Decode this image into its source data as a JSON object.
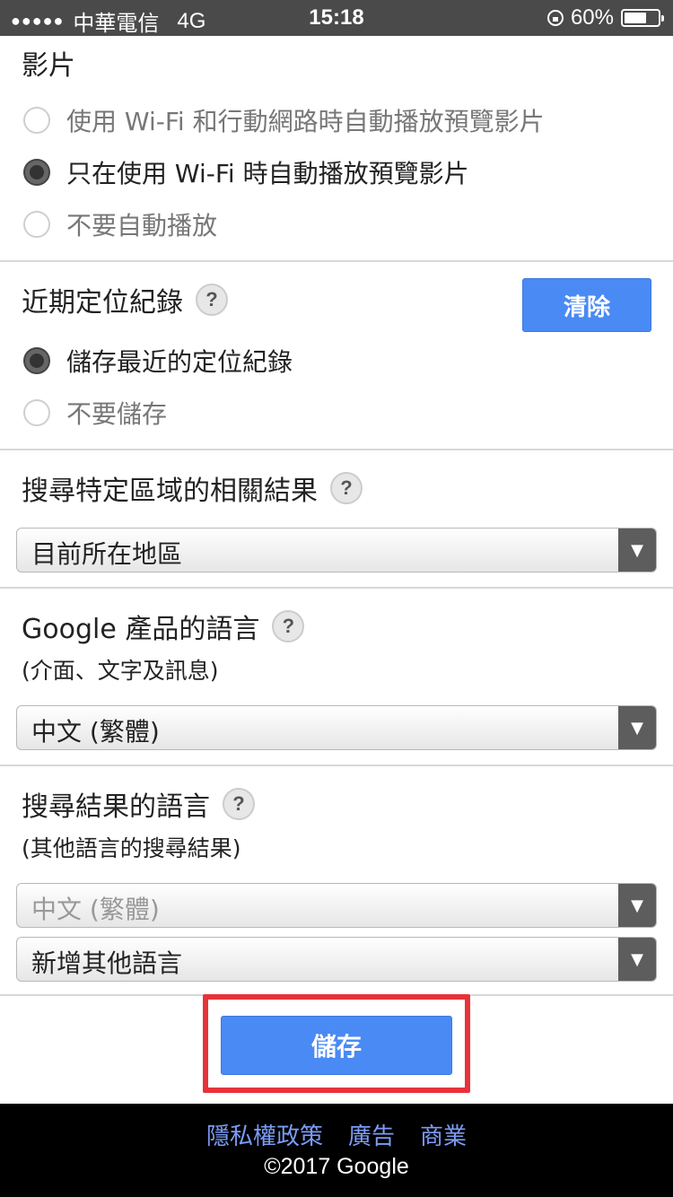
{
  "status_bar": {
    "signal_dots": "●●●●●",
    "carrier": "中華電信",
    "network": "4G",
    "time": "15:18",
    "battery_percent": "60%",
    "battery_level": 0.6
  },
  "video_section": {
    "title": "影片",
    "options": [
      {
        "label": "使用 Wi-Fi 和行動網路時自動播放預覽影片",
        "checked": false
      },
      {
        "label": "只在使用 Wi-Fi 時自動播放預覽影片",
        "checked": true
      },
      {
        "label": "不要自動播放",
        "checked": false
      }
    ]
  },
  "location_section": {
    "title": "近期定位紀錄",
    "help_icon": "?",
    "clear_button": "清除",
    "options": [
      {
        "label": "儲存最近的定位紀錄",
        "checked": true
      },
      {
        "label": "不要儲存",
        "checked": false
      }
    ]
  },
  "region_section": {
    "title": "搜尋特定區域的相關結果",
    "help_icon": "?",
    "select_value": "目前所在地區"
  },
  "product_language_section": {
    "title": "Google 產品的語言",
    "subtitle": "(介面、文字及訊息)",
    "help_icon": "?",
    "select_value": "中文 (繁體)"
  },
  "result_language_section": {
    "title": "搜尋結果的語言",
    "subtitle": "(其他語言的搜尋結果)",
    "help_icon": "?",
    "select_value_disabled": "中文 (繁體)",
    "select_add": "新增其他語言"
  },
  "save_button": "儲存",
  "colors": {
    "accent": "#4a8af4",
    "highlight": "#e8323a",
    "footer_link": "#7b9cf5"
  },
  "footer": {
    "links": [
      "隱私權政策",
      "廣告",
      "商業"
    ],
    "copyright": "©2017 Google"
  }
}
